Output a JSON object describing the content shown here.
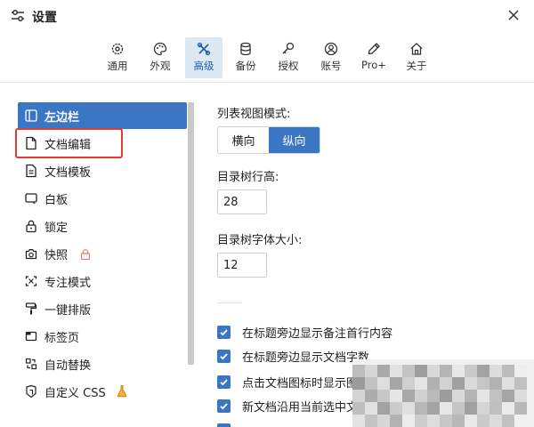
{
  "window": {
    "title": "设置",
    "title_icon": "sliders-icon",
    "close_icon": "close-icon"
  },
  "tabs": [
    {
      "label": "通用",
      "icon": "gear-icon",
      "active": false
    },
    {
      "label": "外观",
      "icon": "palette-icon",
      "active": false
    },
    {
      "label": "高级",
      "icon": "tools-icon",
      "active": true
    },
    {
      "label": "备份",
      "icon": "database-icon",
      "active": false
    },
    {
      "label": "授权",
      "icon": "key-icon",
      "active": false
    },
    {
      "label": "账号",
      "icon": "user-circle-icon",
      "active": false
    },
    {
      "label": "Pro+",
      "icon": "pen-icon",
      "active": false
    },
    {
      "label": "关于",
      "icon": "home-icon",
      "active": false
    }
  ],
  "sidebar": {
    "items": [
      {
        "label": "左边栏",
        "icon": "sidebar-icon",
        "active": true
      },
      {
        "label": "文档编辑",
        "icon": "file-icon",
        "active": false,
        "highlighted": true
      },
      {
        "label": "文档模板",
        "icon": "file-text-icon",
        "active": false
      },
      {
        "label": "白板",
        "icon": "whiteboard-icon",
        "active": false
      },
      {
        "label": "锁定",
        "icon": "lock-icon",
        "active": false
      },
      {
        "label": "快照",
        "icon": "camera-icon",
        "active": false,
        "badge": "lock-badge-icon"
      },
      {
        "label": "专注模式",
        "icon": "focus-icon",
        "active": false
      },
      {
        "label": "一键排版",
        "icon": "paint-roller-icon",
        "active": false
      },
      {
        "label": "标签页",
        "icon": "tab-window-icon",
        "active": false
      },
      {
        "label": "自动替换",
        "icon": "replace-icon",
        "active": false
      },
      {
        "label": "自定义 CSS",
        "icon": "css-icon",
        "active": false,
        "badge": "flask-icon"
      }
    ]
  },
  "main": {
    "list_view_mode": {
      "label": "列表视图模式:",
      "options": [
        "横向",
        "纵向"
      ],
      "selected": "纵向"
    },
    "tree_row_height": {
      "label": "目录树行高:",
      "value": "28"
    },
    "tree_font_size": {
      "label": "目录树字体大小:",
      "value": "12"
    },
    "checkboxes": [
      {
        "label": "在标题旁边显示备注首行内容",
        "checked": true
      },
      {
        "label": "在标题旁边显示文档字数",
        "checked": true
      },
      {
        "label": "点击文档图标时显示图标",
        "checked": true
      },
      {
        "label": "新文档沿用当前选中文档",
        "checked": true
      }
    ]
  },
  "colors": {
    "accent": "#3a76c4",
    "active_tab_bg": "#dde8f5",
    "highlight_border": "#e23a2e"
  }
}
